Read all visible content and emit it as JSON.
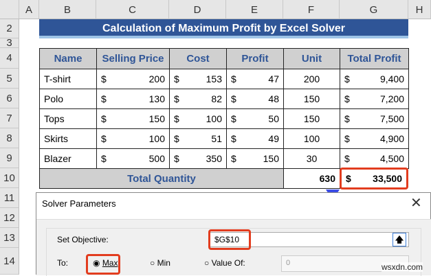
{
  "columns": [
    "A",
    "B",
    "C",
    "D",
    "E",
    "F",
    "G",
    "H"
  ],
  "rows": [
    "2",
    "3",
    "4",
    "5",
    "6",
    "7",
    "8",
    "9",
    "10",
    "11",
    "12",
    "13",
    "14"
  ],
  "title": "Calculation of Maximum Profit by Excel Solver",
  "headers": [
    "Name",
    "Selling Price",
    "Cost",
    "Profit",
    "Unit",
    "Total Profit"
  ],
  "data": [
    [
      "T-shirt",
      "200",
      "153",
      "47",
      "200",
      "9,400"
    ],
    [
      "Polo",
      "130",
      "82",
      "48",
      "150",
      "7,200"
    ],
    [
      "Tops",
      "150",
      "100",
      "50",
      "150",
      "7,500"
    ],
    [
      "Skirts",
      "100",
      "51",
      "49",
      "100",
      "4,900"
    ],
    [
      "Blazer",
      "500",
      "350",
      "150",
      "30",
      "4,500"
    ]
  ],
  "currency": "$",
  "total": {
    "label": "Total Quantity",
    "unit": "630",
    "profit": "33,500"
  },
  "dialog": {
    "title": "Solver Parameters",
    "objective_label": "Set Objective:",
    "objective_value": "$G$10",
    "to_label": "To:",
    "max": "Max",
    "min": "Min",
    "value_of": "Value Of:",
    "value_of_value": "0"
  },
  "watermark": "wsxdn.com"
}
